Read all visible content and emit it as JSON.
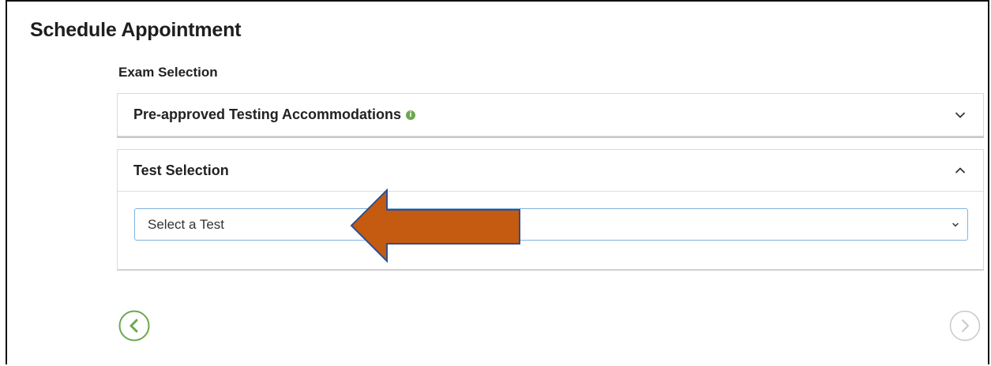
{
  "page": {
    "title": "Schedule Appointment",
    "section_label": "Exam Selection"
  },
  "accommodations_panel": {
    "title": "Pre-approved Testing Accommodations",
    "info_icon_glyph": "i",
    "expanded": false
  },
  "test_panel": {
    "title": "Test Selection",
    "expanded": true,
    "select": {
      "selected_value": "Select a Test"
    }
  },
  "navigation": {
    "prev_icon": "chevron-left-circle-icon",
    "next_icon": "chevron-right-circle-icon",
    "next_disabled": true
  },
  "annotation": {
    "type": "left-arrow",
    "fill_color": "#c55a11",
    "stroke_color": "#2f4f8f"
  },
  "colors": {
    "accent_green": "#6aa84f",
    "select_border": "#7fb3e0",
    "disabled_gray": "#c9c9c9"
  }
}
